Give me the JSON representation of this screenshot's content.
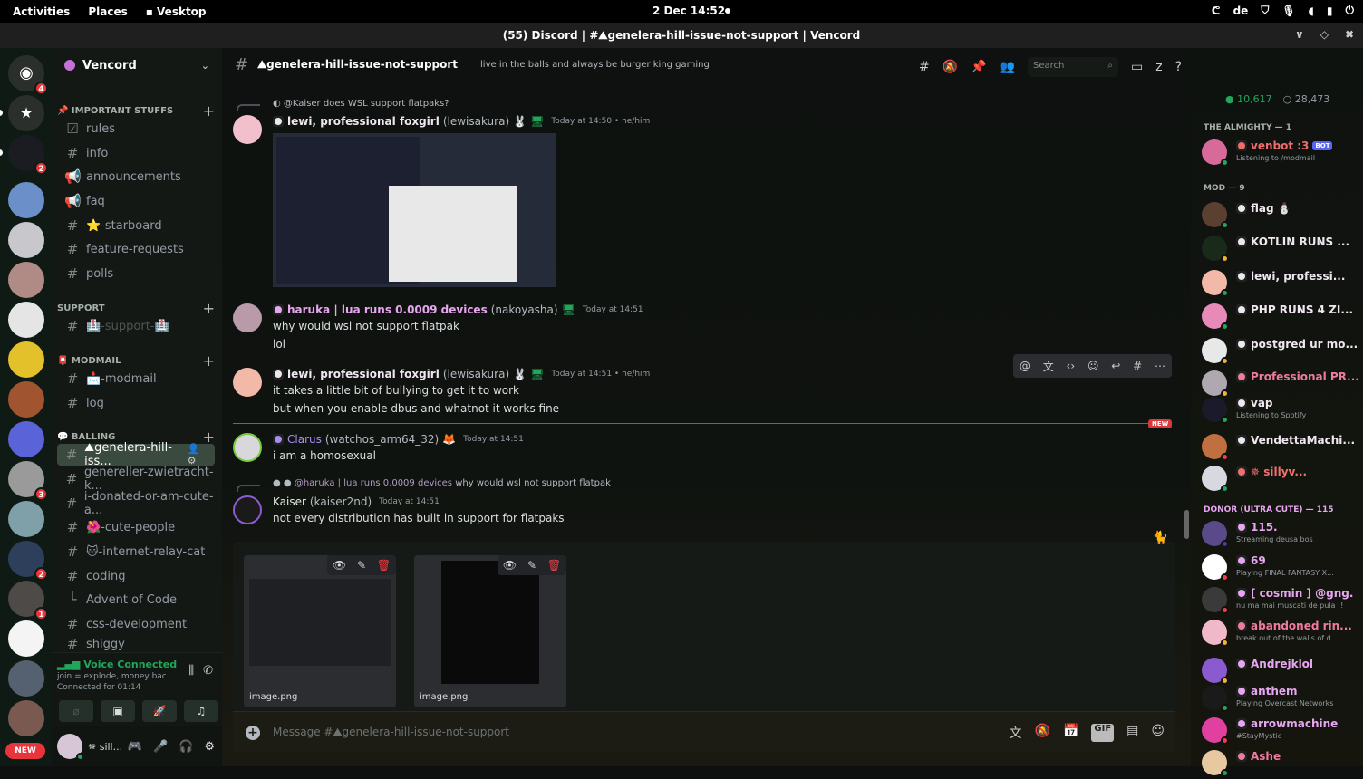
{
  "topbar": {
    "activities": "Activities",
    "places": "Places",
    "app": "Vesktop",
    "clock": "2 Dec  14:52",
    "keyboard": "de"
  },
  "window": {
    "title": "(55) Discord | #⛰genelera-hill-issue-not-support | Vencord"
  },
  "guilds": {
    "home_badge": "4",
    "badges": [
      "2",
      "3",
      "2",
      "1"
    ],
    "new_label": "NEW"
  },
  "server": {
    "name": "Vencord"
  },
  "categories": [
    {
      "name": "📌 IMPORTANT STUFFS"
    },
    {
      "name": "SUPPORT"
    },
    {
      "name": "📮 MODMAIL"
    },
    {
      "name": "💬 BALLING"
    }
  ],
  "channels": [
    {
      "icon": "☑",
      "name": "rules"
    },
    {
      "icon": "#",
      "name": "info"
    },
    {
      "icon": "📢",
      "name": "announcements"
    },
    {
      "icon": "📢",
      "name": "faq"
    },
    {
      "icon": "#",
      "name": "⭐-starboard"
    },
    {
      "icon": "#",
      "name": "feature-requests"
    },
    {
      "icon": "#",
      "name": "polls"
    },
    {
      "icon": "#",
      "name": "🏥-support-🏥"
    },
    {
      "icon": "#",
      "name": "📩-modmail"
    },
    {
      "icon": "#",
      "name": "log"
    },
    {
      "icon": "#",
      "name": "⛰genelera-hill-iss..."
    },
    {
      "icon": "#",
      "name": "genereller-zwietracht-k..."
    },
    {
      "icon": "#",
      "name": "i-donated-or-am-cute-a..."
    },
    {
      "icon": "#",
      "name": "🌺-cute-people"
    },
    {
      "icon": "#",
      "name": "🐱-internet-relay-cat"
    },
    {
      "icon": "#",
      "name": "coding"
    },
    {
      "icon": "└",
      "name": "Advent of Code"
    },
    {
      "icon": "#",
      "name": "css-development"
    },
    {
      "icon": "#",
      "name": "shiggy"
    }
  ],
  "voice": {
    "status": "Voice Connected",
    "channel": "join = explode, money back i...",
    "connected_for": "Connected for 01:14"
  },
  "user": {
    "name": "✵ sill..."
  },
  "chat": {
    "channel_name": "⛰genelera-hill-issue-not-support",
    "topic": "live in the balls and always be burger king gaming",
    "search_placeholder": "Search",
    "composer_placeholder": "Message #⛰genelera-hill-issue-not-support",
    "new_label": "NEW",
    "messages": [
      {
        "reply": "@Kaiser does WSL support flatpaks?",
        "display": "lewi, professional foxgirl",
        "handle": "(lewisakura)",
        "time": "Today at 14:50 • he/him",
        "lines": [],
        "color": "#f0e6f0"
      },
      {
        "display": "haruka | lua runs 0.0009 devices",
        "handle": "(nakoyasha)",
        "time": "Today at 14:51",
        "lines": [
          "why would wsl not support flatpak",
          "lol"
        ],
        "color": "#e7a6f0"
      },
      {
        "display": "lewi, professional foxgirl",
        "handle": "(lewisakura)",
        "time": "Today at 14:51 • he/him",
        "lines": [
          "it takes a little bit of bullying to get it to work",
          "but when you enable dbus and whatnot it works fine"
        ],
        "color": "#f0e6f0"
      },
      {
        "display": "Clarus",
        "handle": "(watchos_arm64_32)",
        "time": "Today at 14:51",
        "lines": [
          "i am a homosexual"
        ],
        "color": "#a88cf0"
      },
      {
        "reply_name": "@haruka | lua runs 0.0009 devices",
        "reply": "why would wsl not support flatpak",
        "display": "Kaiser",
        "handle": "(kaiser2nd)",
        "time": "Today at 14:51",
        "lines": [
          "not every distribution has built in support for flatpaks"
        ],
        "color": "#e8e8e8"
      }
    ],
    "attachments": [
      {
        "name": "image.png"
      },
      {
        "name": "image.png"
      }
    ]
  },
  "members": {
    "online": "10,617",
    "total": "28,473",
    "groups": [
      {
        "title": "THE ALMIGHTY — 1"
      },
      {
        "title": "MOD — 9"
      },
      {
        "title": "DONOR (ULTRA CUTE) — 115"
      }
    ],
    "list": [
      {
        "name": "venbot :3",
        "sub": "Listening to /modmail",
        "color": "#f06b6b",
        "tag": "BOT"
      },
      {
        "name": "flag ⛄",
        "sub": "",
        "color": "#f0e6f0"
      },
      {
        "name": "KOTLIN RUNS ...",
        "sub": "",
        "color": "#f0e6f0"
      },
      {
        "name": "lewi, professi...",
        "sub": "",
        "color": "#f0e6f0"
      },
      {
        "name": "PHP RUNS 4 ZI...",
        "sub": "",
        "color": "#f0e6f0"
      },
      {
        "name": "postgred ur mo...",
        "sub": "",
        "color": "#f0e6f0"
      },
      {
        "name": "Professional PR...",
        "sub": "",
        "color": "#f07ba0"
      },
      {
        "name": "vap",
        "sub": "Listening to Spotify",
        "color": "#f0e6f0"
      },
      {
        "name": "VendettaMachi...",
        "sub": "",
        "color": "#f0e6f0"
      },
      {
        "name": "✵ sillyv...",
        "sub": "",
        "color": "#f07070"
      },
      {
        "name": "115.",
        "sub": "Streaming deusa bos",
        "color": "#e7a6f0"
      },
      {
        "name": "69",
        "sub": "Playing FINAL FANTASY X...",
        "color": "#e7a6f0"
      },
      {
        "name": "[ cosmin ] @gng.",
        "sub": "nu ma mai muscati de pula !!",
        "color": "#e7a6f0"
      },
      {
        "name": "abandoned rin...",
        "sub": "break out of the walls of d...",
        "color": "#f07ba0"
      },
      {
        "name": "Andrejklol",
        "sub": "",
        "color": "#e7a6f0"
      },
      {
        "name": "anthem",
        "sub": "Playing Overcast Networks",
        "color": "#e7a6f0"
      },
      {
        "name": "arrowmachine",
        "sub": "#StayMystic",
        "color": "#e7a6f0"
      },
      {
        "name": "Ashe",
        "sub": "",
        "color": "#f07ba0"
      }
    ]
  }
}
